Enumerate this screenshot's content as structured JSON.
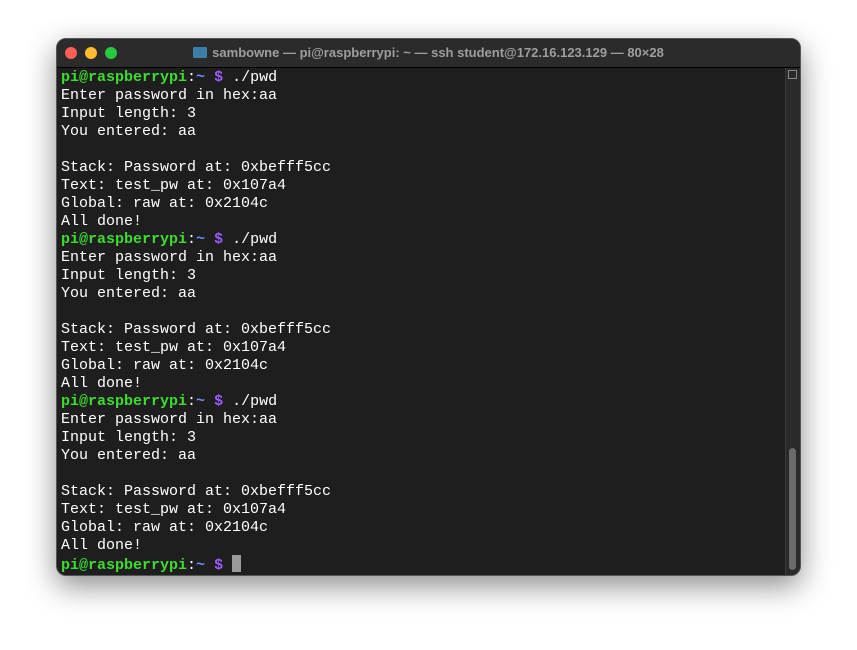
{
  "window": {
    "title": "sambowne — pi@raspberrypi: ~ — ssh student@172.16.123.129 — 80×28"
  },
  "prompt": {
    "user_host": "pi@raspberrypi",
    "colon": ":",
    "dir": "~",
    "sign": "$"
  },
  "lines": [
    {
      "type": "prompt",
      "cmd": " ./pwd"
    },
    {
      "type": "text",
      "text": "Enter password in hex:aa"
    },
    {
      "type": "text",
      "text": "Input length: 3"
    },
    {
      "type": "text",
      "text": "You entered: aa"
    },
    {
      "type": "text",
      "text": ""
    },
    {
      "type": "text",
      "text": "Stack: Password at: 0xbefff5cc"
    },
    {
      "type": "text",
      "text": "Text: test_pw at: 0x107a4"
    },
    {
      "type": "text",
      "text": "Global: raw at: 0x2104c"
    },
    {
      "type": "text",
      "text": "All done!"
    },
    {
      "type": "prompt",
      "cmd": " ./pwd"
    },
    {
      "type": "text",
      "text": "Enter password in hex:aa"
    },
    {
      "type": "text",
      "text": "Input length: 3"
    },
    {
      "type": "text",
      "text": "You entered: aa"
    },
    {
      "type": "text",
      "text": ""
    },
    {
      "type": "text",
      "text": "Stack: Password at: 0xbefff5cc"
    },
    {
      "type": "text",
      "text": "Text: test_pw at: 0x107a4"
    },
    {
      "type": "text",
      "text": "Global: raw at: 0x2104c"
    },
    {
      "type": "text",
      "text": "All done!"
    },
    {
      "type": "prompt",
      "cmd": " ./pwd"
    },
    {
      "type": "text",
      "text": "Enter password in hex:aa"
    },
    {
      "type": "text",
      "text": "Input length: 3"
    },
    {
      "type": "text",
      "text": "You entered: aa"
    },
    {
      "type": "text",
      "text": ""
    },
    {
      "type": "text",
      "text": "Stack: Password at: 0xbefff5cc"
    },
    {
      "type": "text",
      "text": "Text: test_pw at: 0x107a4"
    },
    {
      "type": "text",
      "text": "Global: raw at: 0x2104c"
    },
    {
      "type": "text",
      "text": "All done!"
    },
    {
      "type": "prompt",
      "cmd": " ",
      "cursor": true
    }
  ],
  "colors": {
    "close": "#fe5f57",
    "minimize": "#febc2e",
    "zoom": "#28c840"
  }
}
